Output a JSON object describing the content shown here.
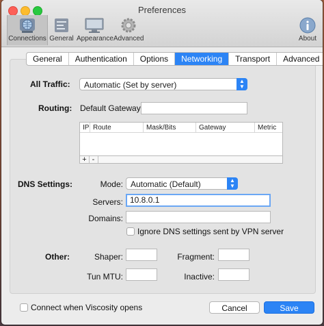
{
  "window": {
    "title": "Preferences"
  },
  "toolbar": {
    "items": [
      {
        "label": "Connections",
        "icon": "connections-globe-icon"
      },
      {
        "label": "General",
        "icon": "general-icon"
      },
      {
        "label": "Appearance",
        "icon": "appearance-monitor-icon"
      },
      {
        "label": "Advanced",
        "icon": "advanced-gear-icon"
      },
      {
        "label": "About",
        "icon": "info-icon"
      }
    ]
  },
  "tabs": [
    "General",
    "Authentication",
    "Options",
    "Networking",
    "Transport",
    "Advanced"
  ],
  "active_tab": "Networking",
  "all_traffic": {
    "label": "All Traffic:",
    "value": "Automatic (Set by server)"
  },
  "routing": {
    "label": "Routing:",
    "gateway_label": "Default Gateway:",
    "gateway_value": "",
    "columns": [
      "IP",
      "Route",
      "Mask/Bits",
      "Gateway",
      "Metric"
    ],
    "add": "+",
    "remove": "-"
  },
  "dns": {
    "label": "DNS Settings:",
    "mode_label": "Mode:",
    "mode_value": "Automatic (Default)",
    "servers_label": "Servers:",
    "servers_value": "10.8.0.1",
    "domains_label": "Domains:",
    "domains_value": "",
    "ignore_label": "Ignore DNS settings sent by VPN server"
  },
  "other": {
    "label": "Other:",
    "shaper_label": "Shaper:",
    "fragment_label": "Fragment:",
    "tunmtu_label": "Tun MTU:",
    "inactive_label": "Inactive:"
  },
  "footer": {
    "connect_label": "Connect when Viscosity opens",
    "cancel": "Cancel",
    "save": "Save"
  },
  "colors": {
    "accent": "#2c84f5"
  }
}
